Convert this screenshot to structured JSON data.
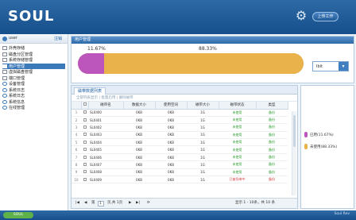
{
  "header": {
    "logo": "SOUL",
    "logo_sub": "",
    "gear_icon": "gear-icon",
    "button_label": "上传工作"
  },
  "sidebar": {
    "user": "user",
    "link": "注销",
    "items": [
      {
        "label": "外壳存储"
      },
      {
        "label": "磁盘分区管理"
      },
      {
        "label": "系统存储管理"
      },
      {
        "label": "用户管理",
        "selected": true
      },
      {
        "label": "虚拟磁盘管理"
      },
      {
        "label": "端口管理"
      },
      {
        "label": "设备管理"
      },
      {
        "label": "系统日志"
      },
      {
        "label": "系统日志"
      },
      {
        "label": "系统信息"
      },
      {
        "label": "在线管理"
      }
    ]
  },
  "bar_panel": {
    "title": "用户管理",
    "used_pct_label": "11.67%",
    "free_pct_label": "88.33%",
    "used_fraction": 0.1167,
    "select_value": "Ibit"
  },
  "grid": {
    "tab": "磁带数据列表",
    "toolbar": "全部列表显示 | 批量启用 | 删除磁带",
    "columns": [
      "",
      "",
      "磁带名",
      "数据大小",
      "使用空间",
      "磁带大小",
      "磁带状态",
      "类型"
    ],
    "rows": [
      {
        "n": "1",
        "name": "SL0400",
        "data": "0KB",
        "used": "0KB",
        "size": "1G",
        "status": "未使用",
        "type": "备份"
      },
      {
        "n": "2",
        "name": "SL0401",
        "data": "0KB",
        "used": "0KB",
        "size": "1G",
        "status": "未使用",
        "type": "备份"
      },
      {
        "n": "3",
        "name": "SL0402",
        "data": "0KB",
        "used": "0KB",
        "size": "1G",
        "status": "未使用",
        "type": "备份"
      },
      {
        "n": "4",
        "name": "SL0403",
        "data": "0KB",
        "used": "0KB",
        "size": "1G",
        "status": "未使用",
        "type": "备份"
      },
      {
        "n": "5",
        "name": "SL0404",
        "data": "0KB",
        "used": "0KB",
        "size": "1G",
        "status": "未使用",
        "type": "备份"
      },
      {
        "n": "6",
        "name": "SL0405",
        "data": "0KB",
        "used": "0KB",
        "size": "1G",
        "status": "未使用",
        "type": "备份"
      },
      {
        "n": "7",
        "name": "SL0406",
        "data": "0KB",
        "used": "0KB",
        "size": "1G",
        "status": "未使用",
        "type": "备份"
      },
      {
        "n": "8",
        "name": "SL0407",
        "data": "0KB",
        "used": "0KB",
        "size": "1G",
        "status": "未使用",
        "type": "备份"
      },
      {
        "n": "9",
        "name": "SL0408",
        "data": "0KB",
        "used": "0KB",
        "size": "1G",
        "status": "未使用",
        "type": "备份"
      },
      {
        "n": "10",
        "name": "SL0409",
        "data": "0KB",
        "used": "0KB",
        "size": "1G",
        "status": "已被导带中",
        "type": "备份",
        "bad": true
      }
    ],
    "pager": {
      "first": "|◀",
      "prev": "◀",
      "page_label": "第",
      "page_value": "1",
      "total_label": "页,共 1页",
      "next": "▶",
      "last": "▶|",
      "refresh": "⟳",
      "summary": "显示 1 - 10条，共 10 条"
    }
  },
  "legend": {
    "items": [
      {
        "label": "已用(11.67%)",
        "color": "#bc56bc"
      },
      {
        "label": "未使用(88.33%)",
        "color": "#e9b24a"
      }
    ]
  },
  "footer": {
    "left_button": "SOUL",
    "right_text": "Soul Rev"
  }
}
